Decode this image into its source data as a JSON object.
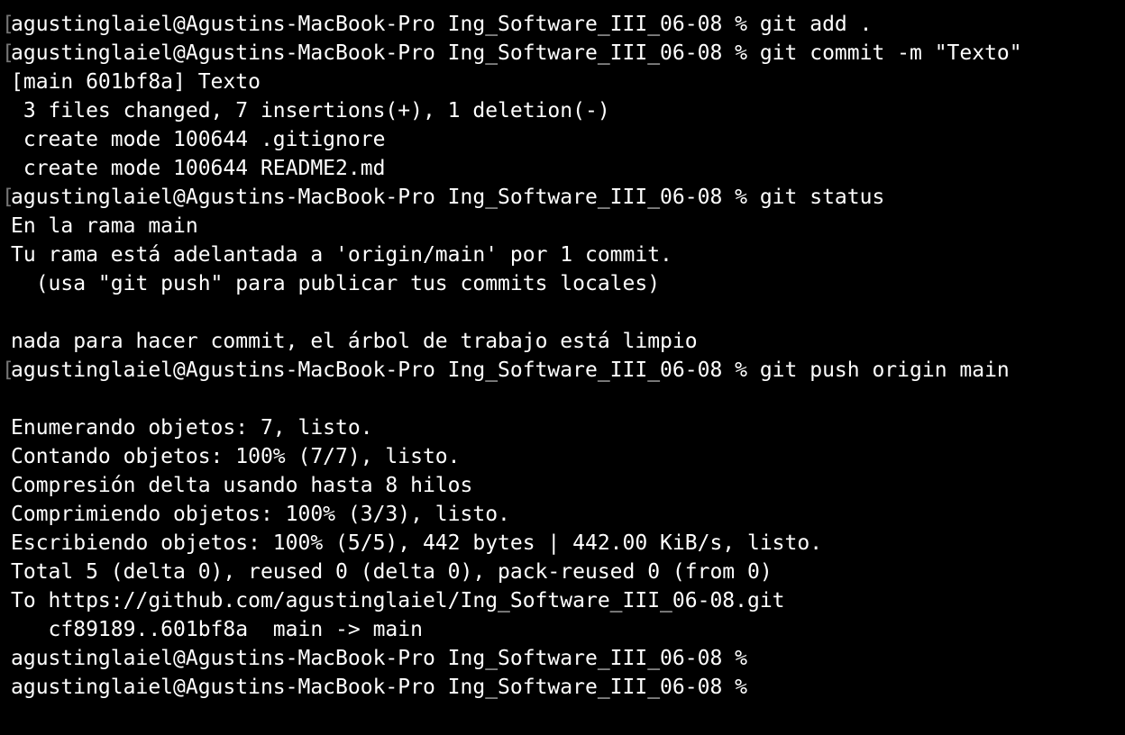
{
  "terminal": {
    "prompt_marker": "[",
    "lines": [
      "agustinglaiel@Agustins-MacBook-Pro Ing_Software_III_06-08 % git add .",
      "agustinglaiel@Agustins-MacBook-Pro Ing_Software_III_06-08 % git commit -m \"Texto\"",
      "[main 601bf8a] Texto",
      " 3 files changed, 7 insertions(+), 1 deletion(-)",
      " create mode 100644 .gitignore",
      " create mode 100644 README2.md",
      "agustinglaiel@Agustins-MacBook-Pro Ing_Software_III_06-08 % git status",
      "En la rama main",
      "Tu rama está adelantada a 'origin/main' por 1 commit.",
      "  (usa \"git push\" para publicar tus commits locales)",
      "",
      "nada para hacer commit, el árbol de trabajo está limpio",
      "agustinglaiel@Agustins-MacBook-Pro Ing_Software_III_06-08 % git push origin main",
      "",
      "Enumerando objetos: 7, listo.",
      "Contando objetos: 100% (7/7), listo.",
      "Compresión delta usando hasta 8 hilos",
      "Comprimiendo objetos: 100% (3/3), listo.",
      "Escribiendo objetos: 100% (5/5), 442 bytes | 442.00 KiB/s, listo.",
      "Total 5 (delta 0), reused 0 (delta 0), pack-reused 0 (from 0)",
      "To https://github.com/agustinglaiel/Ing_Software_III_06-08.git",
      "   cf89189..601bf8a  main -> main",
      "agustinglaiel@Agustins-MacBook-Pro Ing_Software_III_06-08 %",
      "agustinglaiel@Agustins-MacBook-Pro Ing_Software_III_06-08 %"
    ]
  }
}
